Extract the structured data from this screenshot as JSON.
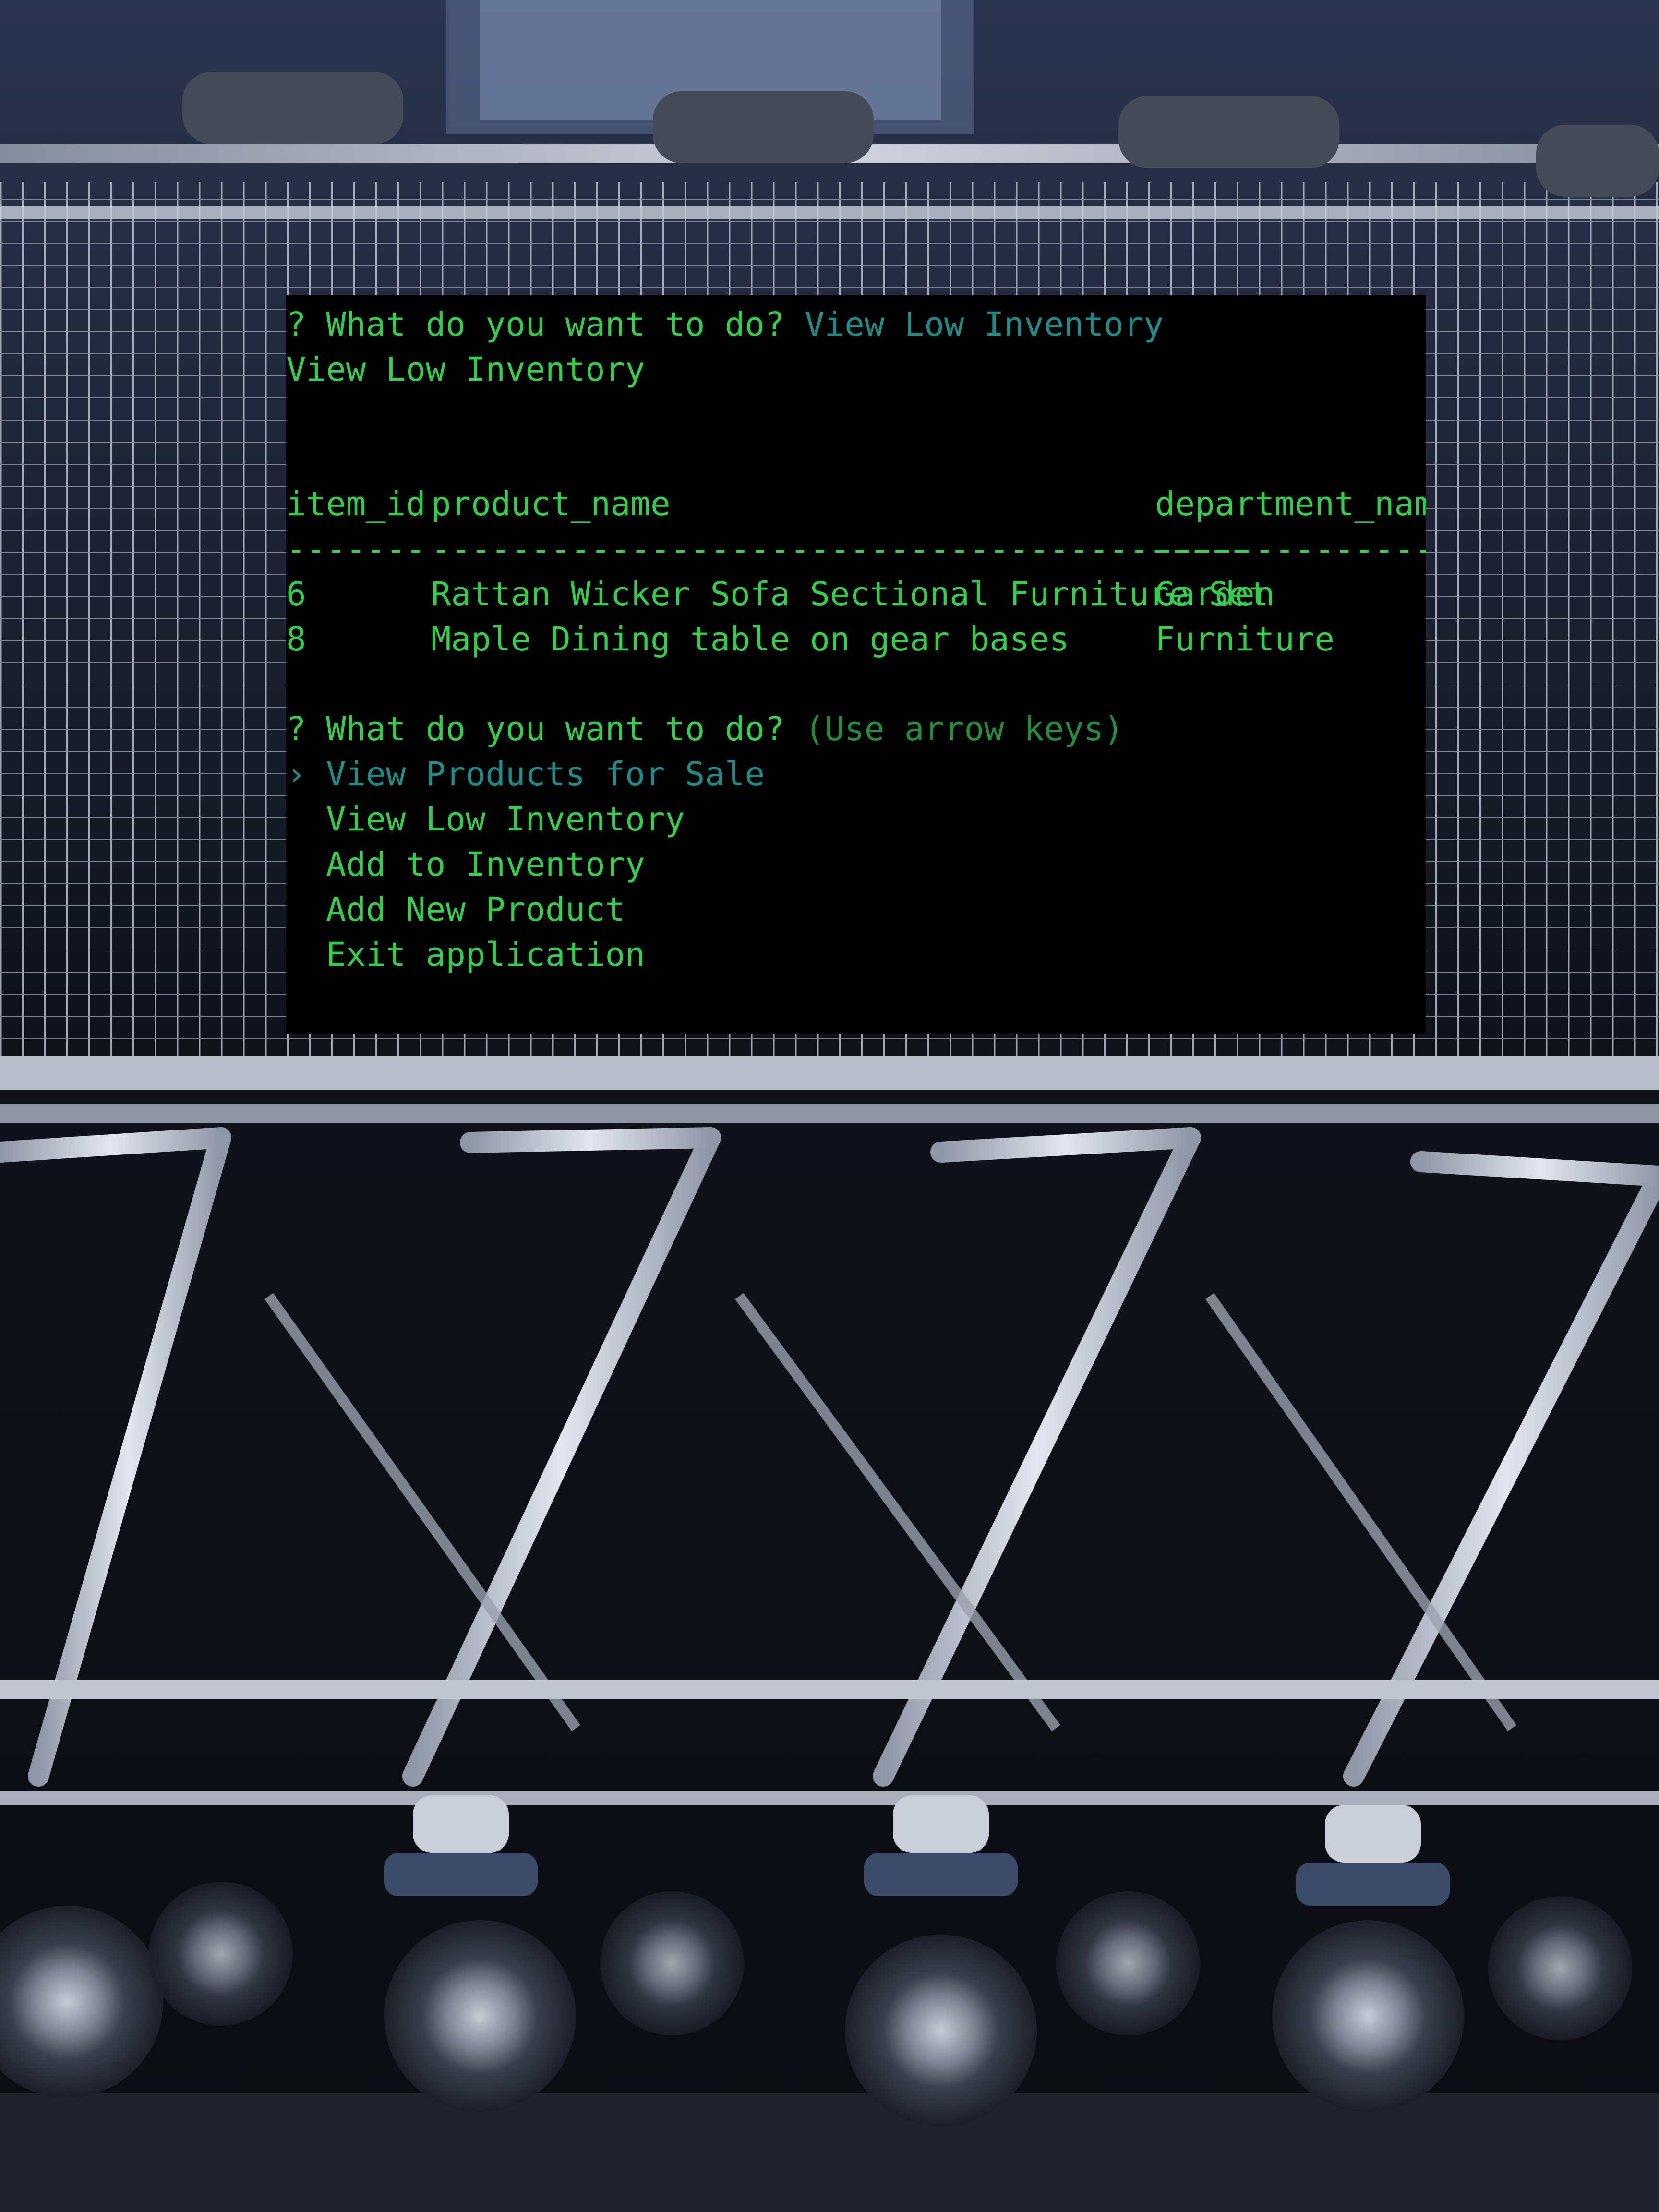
{
  "terminal": {
    "prompt_mark": "?",
    "question": "What do you want to do?",
    "answer": "View Low Inventory",
    "echo": "View Low Inventory",
    "table": {
      "headers": [
        "item_id",
        "product_name",
        "department_name"
      ],
      "separators": [
        "-------",
        "-----------------------------------------",
        "---------------"
      ],
      "rows": [
        [
          "6",
          "Rattan Wicker Sofa Sectional Furniture Set",
          "Garden"
        ],
        [
          "8",
          "Maple Dining table on gear bases",
          "Furniture"
        ]
      ]
    },
    "prompt2": {
      "question": "What do you want to do?",
      "hint": "(Use arrow keys)",
      "pointer": "›",
      "choices": [
        "View Products for Sale",
        "View Low Inventory",
        "Add to Inventory",
        "Add New Product",
        "Exit application"
      ]
    }
  },
  "colors": {
    "terminal_bg": "#000000",
    "text_green": "#2fd14a",
    "answer_teal": "#1b8e8a",
    "hint_green": "#1f8f3a"
  }
}
